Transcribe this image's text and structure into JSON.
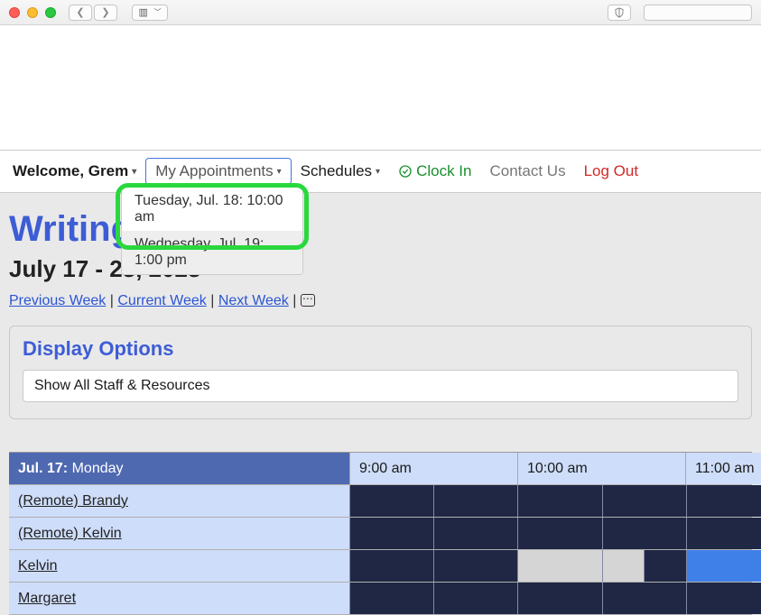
{
  "menubar": {
    "welcome": "Welcome, Grem",
    "my_appointments": "My Appointments",
    "schedules": "Schedules",
    "clock_in": "Clock In",
    "contact_us": "Contact Us",
    "log_out": "Log Out"
  },
  "appointments_dropdown": [
    "Tuesday, Jul. 18: 10:00 am",
    "Wednesday, Jul. 19: 1:00 pm"
  ],
  "page": {
    "title": "Writing",
    "date_range": "July 17 - 23, 2023",
    "prev_week": "Previous Week",
    "current_week": "Current Week",
    "next_week": "Next Week"
  },
  "display_options": {
    "heading": "Display Options",
    "selected": "Show All Staff & Resources"
  },
  "schedule": {
    "day_short": "Jul. 17:",
    "day_name": "Monday",
    "times": [
      "9:00 am",
      "10:00 am",
      "11:00 am"
    ],
    "rows": [
      {
        "name": "(Remote) Brandy",
        "slots": [
          "navy",
          "navy",
          "navy",
          "navy",
          "navy"
        ]
      },
      {
        "name": "(Remote) Kelvin",
        "slots": [
          "navy",
          "navy",
          "navy",
          "navy",
          "navy"
        ]
      },
      {
        "name": "Kelvin",
        "slots": [
          "navy",
          "navy",
          "gray",
          "gray-navy",
          "blue"
        ]
      },
      {
        "name": "Margaret",
        "slots": [
          "navy",
          "navy",
          "navy",
          "navy",
          "navy"
        ]
      }
    ]
  }
}
